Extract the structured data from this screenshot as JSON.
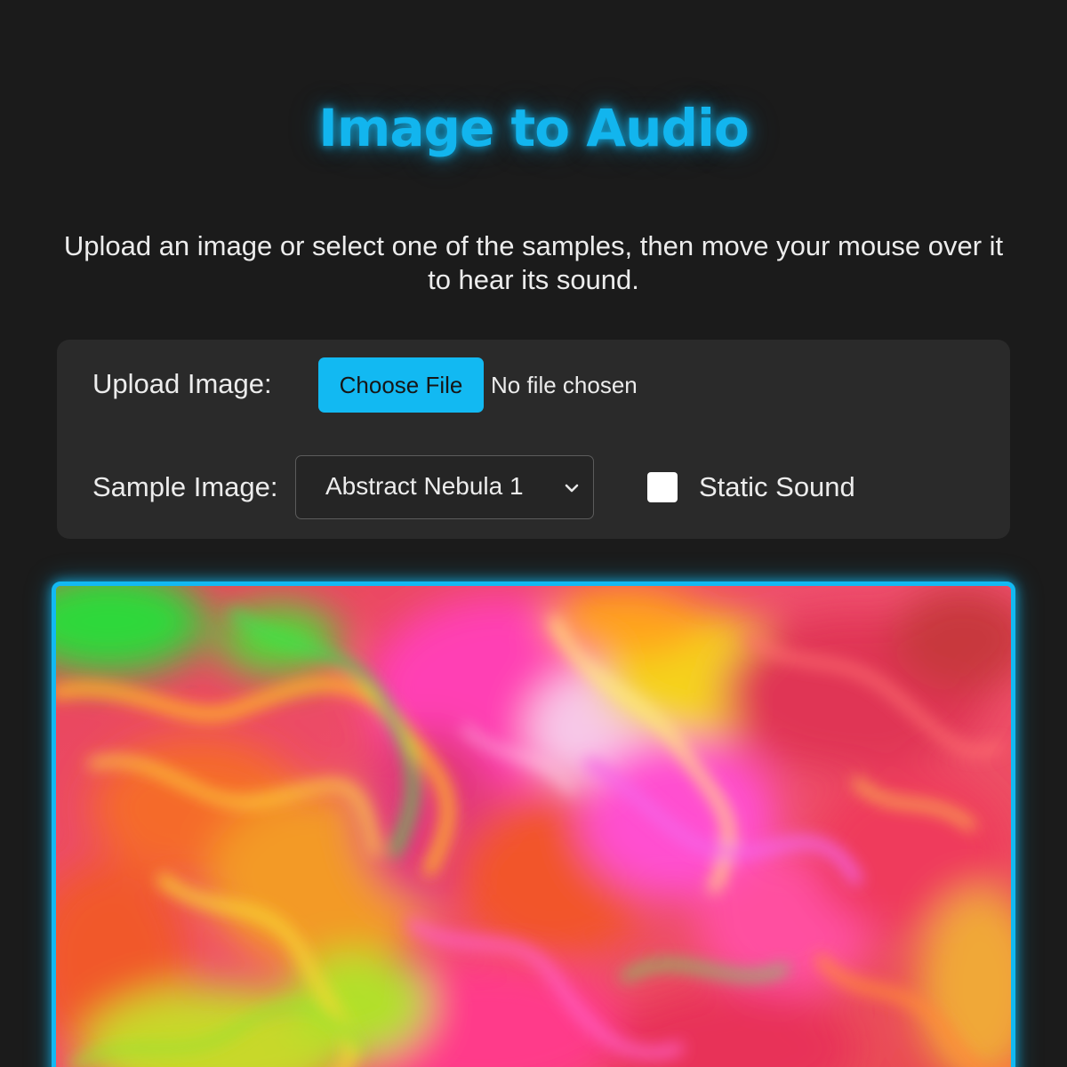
{
  "header": {
    "title": "Image to Audio",
    "subtitle": "Upload an image or select one of the samples, then move your mouse over it to hear its sound."
  },
  "controls": {
    "upload_label": "Upload Image:",
    "choose_file_label": "Choose File",
    "file_status": "No file chosen",
    "sample_label": "Sample Image:",
    "sample_selected": "Abstract Nebula 1",
    "static_sound_label": "Static Sound",
    "static_sound_checked": false
  },
  "canvas": {
    "image_description_name": "abstract-swirl-image"
  },
  "colors": {
    "accent": "#12b9f2",
    "background": "#1b1b1b",
    "panel": "#2a2a2a"
  },
  "icons": {
    "select_arrow": "chevron-down-icon"
  }
}
